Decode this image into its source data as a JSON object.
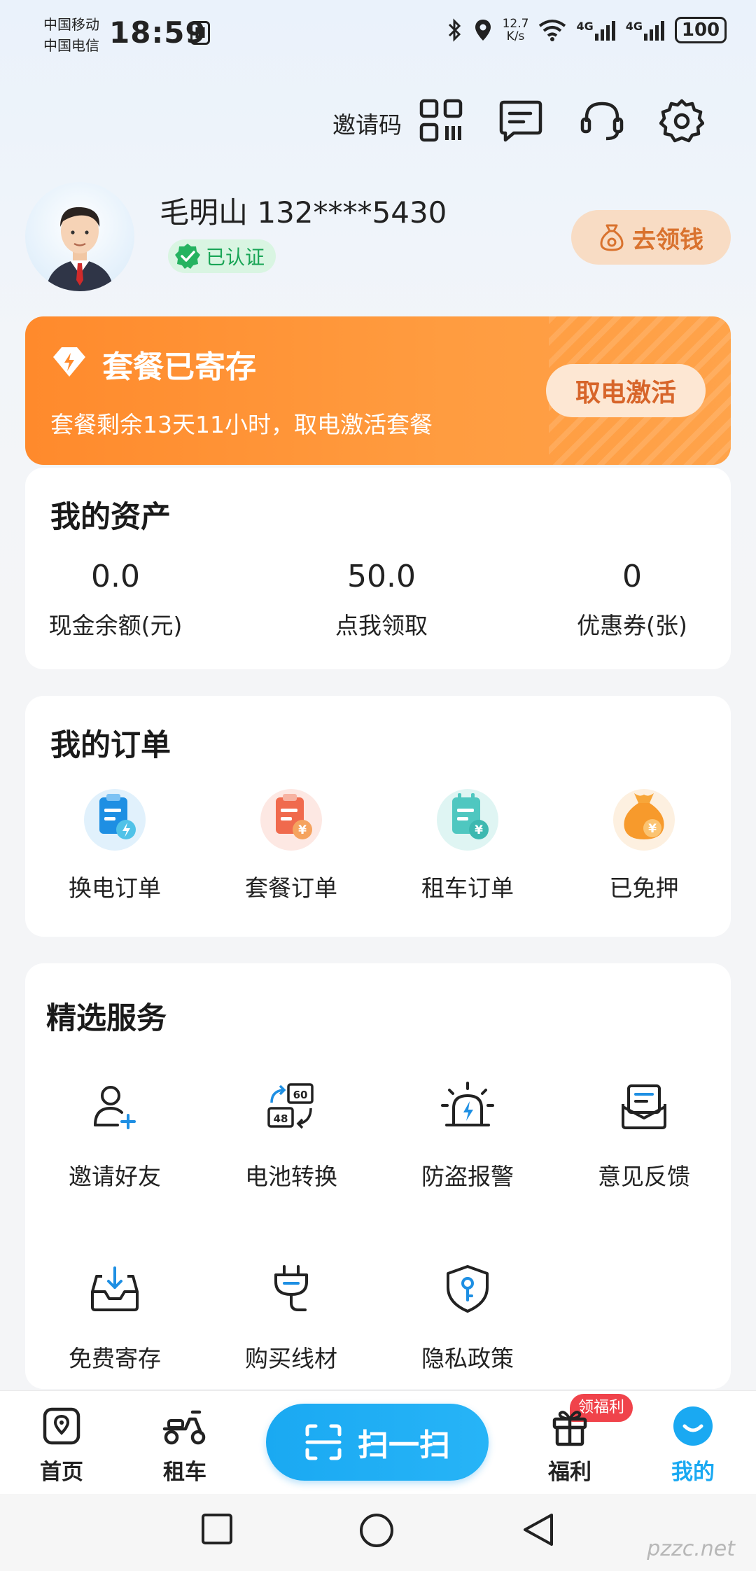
{
  "status_bar": {
    "carrier_1": "中国移动",
    "carrier_2": "中国电信",
    "time": "18:59",
    "nfc": "N",
    "speed_value": "12.7",
    "speed_unit": "K/s",
    "net_1": "4G",
    "net_2": "4G",
    "battery": "100"
  },
  "header": {
    "invite_code_label": "邀请码",
    "icons": [
      "qr-code-icon",
      "message-icon",
      "headset-icon",
      "gear-icon"
    ]
  },
  "profile": {
    "name_phone": "毛明山 132****5430",
    "verified_label": "已认证",
    "get_money_label": "去领钱"
  },
  "banner": {
    "title": "套餐已寄存",
    "subtitle": "套餐剩余13天11小时，取电激活套餐",
    "button_label": "取电激活"
  },
  "assets": {
    "title": "我的资产",
    "items": [
      {
        "value": "0.0",
        "label": "现金余额(元)"
      },
      {
        "value": "50.0",
        "label": "点我领取"
      },
      {
        "value": "0",
        "label": "优惠券(张)"
      }
    ]
  },
  "orders": {
    "title": "我的订单",
    "items": [
      {
        "label": "换电订单",
        "icon": "swap-order-icon"
      },
      {
        "label": "套餐订单",
        "icon": "package-order-icon"
      },
      {
        "label": "租车订单",
        "icon": "rental-order-icon"
      },
      {
        "label": "已免押",
        "icon": "money-bag-icon"
      }
    ]
  },
  "services": {
    "title": "精选服务",
    "items": [
      {
        "label": "邀请好友",
        "icon": "add-user-icon"
      },
      {
        "label": "电池转换",
        "icon": "battery-convert-icon"
      },
      {
        "label": "防盗报警",
        "icon": "alarm-icon"
      },
      {
        "label": "意见反馈",
        "icon": "feedback-icon"
      },
      {
        "label": "免费寄存",
        "icon": "storage-icon"
      },
      {
        "label": "购买线材",
        "icon": "cable-icon"
      },
      {
        "label": "隐私政策",
        "icon": "privacy-shield-icon"
      }
    ]
  },
  "bottom_nav": {
    "home": "首页",
    "rent": "租车",
    "scan": "扫一扫",
    "welfare": "福利",
    "welfare_badge": "领福利",
    "me": "我的"
  },
  "colors": {
    "orange": "#ff8a2c",
    "blue": "#1aa9f2",
    "green": "#19a556",
    "active_nav": "#1aa9f2"
  },
  "watermark": "pzzc.net"
}
